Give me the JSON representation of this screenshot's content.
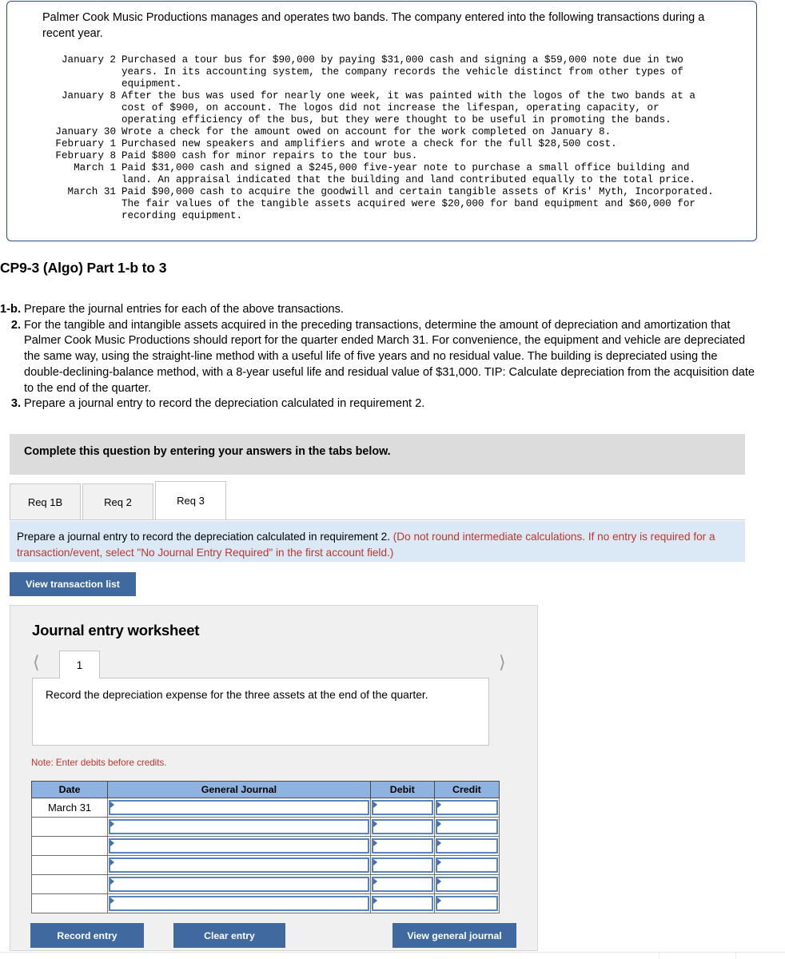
{
  "transaction_box": {
    "intro": "Palmer Cook Music Productions manages and operates two bands. The company entered into the following transactions during a recent year.",
    "rows": [
      {
        "date": "January 2",
        "description": "Purchased a tour bus for $90,000 by paying $31,000 cash and signing a $59,000 note due in two\nyears. In its accounting system, the company records the vehicle distinct from other types of\nequipment."
      },
      {
        "date": "January 8",
        "description": "After the bus was used for nearly one week, it was painted with the logos of the two bands at a\ncost of $900, on account. The logos did not increase the lifespan, operating capacity, or\noperating efficiency of the bus, but they were thought to be useful in promoting the bands."
      },
      {
        "date": "January 30",
        "description": "Wrote a check for the amount owed on account for the work completed on January 8."
      },
      {
        "date": "February 1",
        "description": "Purchased new speakers and amplifiers and wrote a check for the full $28,500 cost."
      },
      {
        "date": "February 8",
        "description": "Paid $800 cash for minor repairs to the tour bus."
      },
      {
        "date": "March 1",
        "description": "Paid $31,000 cash and signed a $245,000 five-year note to purchase a small office building and\nland. An appraisal indicated that the building and land contributed equally to the total price."
      },
      {
        "date": "March 31",
        "description": "Paid $90,000 cash to acquire the goodwill and certain tangible assets of Kris' Myth, Incorporated.\nThe fair values of the tangible assets acquired were $20,000 for band equipment and $60,000 for\nrecording equipment."
      }
    ]
  },
  "part_heading": "CP9-3 (Algo) Part 1-b to 3",
  "requirements": [
    {
      "number": "1-b.",
      "text": "Prepare the journal entries for each of the above transactions."
    },
    {
      "number": "2.",
      "text": "For the tangible and intangible assets acquired in the preceding transactions, determine the amount of depreciation and amortization that Palmer Cook Music Productions should report for the quarter ended March 31. For convenience, the equipment and vehicle are depreciated the same way, using the straight-line method with a useful life of five years and no residual value. The building is depreciated using the double-declining-balance method, with a 8-year useful life and residual value of $31,000. TIP: Calculate depreciation from the acquisition date to the end of the quarter."
    },
    {
      "number": "3.",
      "text": "Prepare a journal entry to record the depreciation calculated in requirement 2."
    }
  ],
  "gray_band": {
    "text": "Complete this question by entering your answers in the tabs below."
  },
  "tabs": [
    {
      "label": "Req 1B",
      "active": false
    },
    {
      "label": "Req 2",
      "active": false
    },
    {
      "label": "Req 3",
      "active": true
    }
  ],
  "blue_band": {
    "black_text": "Prepare a journal entry to record the depreciation calculated in requirement 2.",
    "red_text": "(Do not round intermediate calculations. If no entry is required for a transaction/event, select \"No Journal Entry Required\" in the first account field.)"
  },
  "buttons": {
    "view_transaction_list": "View transaction list",
    "record_entry": "Record entry",
    "clear_entry": "Clear entry",
    "view_general_journal": "View general journal"
  },
  "worksheet": {
    "title": "Journal entry worksheet",
    "pager": {
      "prev_icon": "chevron-left-icon",
      "next_icon": "chevron-right-icon",
      "current_page": "1"
    },
    "prompt": "Record the depreciation expense for the three assets at the end of the quarter.",
    "note": "Note: Enter debits before credits.",
    "table": {
      "headers": [
        "Date",
        "General Journal",
        "Debit",
        "Credit"
      ],
      "rows": [
        {
          "date": "March 31",
          "general_journal": "",
          "debit": "",
          "credit": ""
        },
        {
          "date": "",
          "general_journal": "",
          "debit": "",
          "credit": ""
        },
        {
          "date": "",
          "general_journal": "",
          "debit": "",
          "credit": ""
        },
        {
          "date": "",
          "general_journal": "",
          "debit": "",
          "credit": ""
        },
        {
          "date": "",
          "general_journal": "",
          "debit": "",
          "credit": ""
        },
        {
          "date": "",
          "general_journal": "",
          "debit": "",
          "credit": ""
        }
      ]
    }
  },
  "colors": {
    "box_border": "#2b4a8b",
    "button_blue": "#40699f",
    "table_header_blue": "#8fb3e0",
    "field_border": "#5783be",
    "banner_blue": "#dbe9f7",
    "banner_gray": "#dcdcdc",
    "red_text": "#c0342b"
  }
}
